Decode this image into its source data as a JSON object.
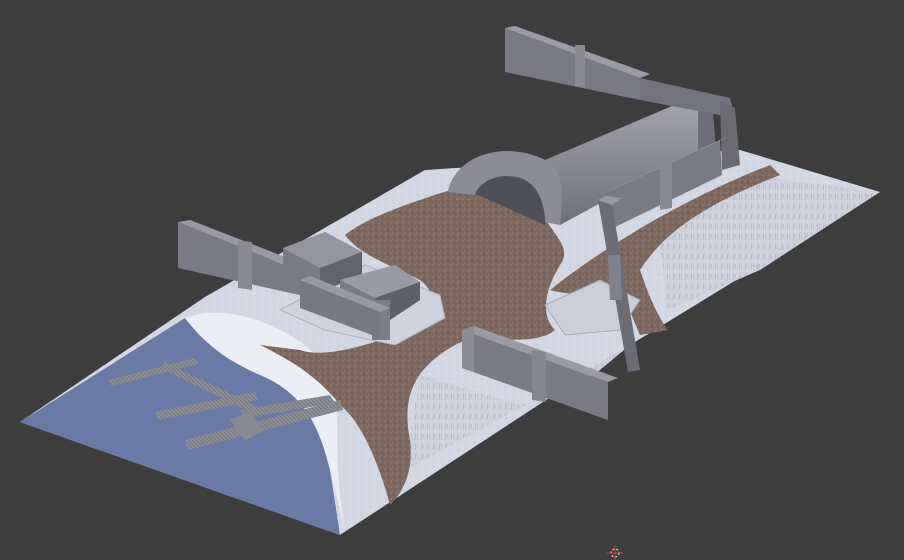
{
  "viewport": {
    "background": "#3d3d3d"
  },
  "scene": {
    "palette": {
      "snow": "#d7d9e6",
      "snow_shade": "#c3c6d6",
      "grass": "#c9ccd8",
      "dirt": "#7d675f",
      "dirt_dark": "#6d5952",
      "water": "#6b7ba8",
      "wall_front": "#7a7a86",
      "wall_top": "#9a9aa6",
      "wall_side": "#5e5e68",
      "hangar_roof": "#8f8f9b",
      "hangar_shadow": "#66666f",
      "pier": "#8b8b93"
    },
    "icons": [
      "cursor-crosshair-icon"
    ]
  }
}
